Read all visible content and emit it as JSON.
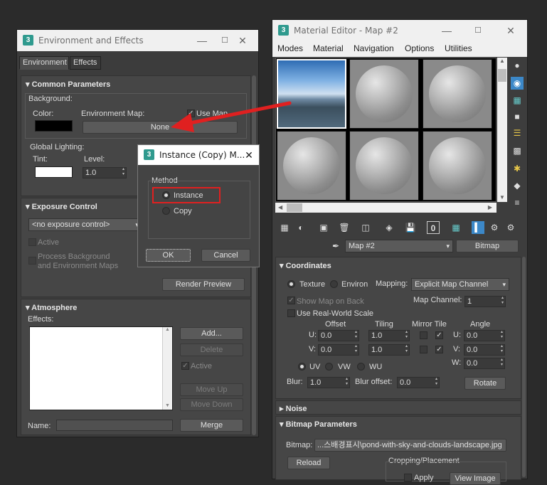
{
  "env": {
    "title": "Environment and Effects",
    "tabs": [
      "Environment",
      "Effects"
    ],
    "common": {
      "header": "Common Parameters",
      "background": "Background:",
      "color": "Color:",
      "envmap": "Environment Map:",
      "usemap": "Use Map",
      "none_btn": "None",
      "global": "Global Lighting:",
      "tint": "Tint:",
      "level": "Level:",
      "level_val": "1.0"
    },
    "exposure": {
      "header": "Exposure Control",
      "dropdown": "<no exposure control>",
      "active": "Active",
      "process_bg_1": "Process Background",
      "process_bg_2": "and Environment Maps",
      "render_preview": "Render Preview"
    },
    "atmosphere": {
      "header": "Atmosphere",
      "effects": "Effects:",
      "add": "Add...",
      "delete": "Delete",
      "active": "Active",
      "move_up": "Move Up",
      "move_down": "Move Down",
      "name": "Name:",
      "merge": "Merge"
    }
  },
  "dialog": {
    "title": "Instance (Copy) M...",
    "method": "Method",
    "instance": "Instance",
    "copy": "Copy",
    "ok": "OK",
    "cancel": "Cancel"
  },
  "mat": {
    "title": "Material Editor - Map #2",
    "menu": [
      "Modes",
      "Material",
      "Navigation",
      "Options",
      "Utilities"
    ],
    "map_name": "Map #2",
    "map_type": "Bitmap",
    "coords": {
      "header": "Coordinates",
      "texture": "Texture",
      "environ": "Environ",
      "mapping": "Mapping:",
      "mapping_val": "Explicit Map Channel",
      "show_map": "Show Map on Back",
      "map_channel": "Map Channel:",
      "map_channel_val": "1",
      "real_world": "Use Real-World Scale",
      "offset": "Offset",
      "tiling": "Tiling",
      "mirror_tile": "Mirror Tile",
      "angle": "Angle",
      "u": "U:",
      "v": "V:",
      "w": "W:",
      "u_off": "0.0",
      "v_off": "0.0",
      "u_tile": "1.0",
      "v_tile": "1.0",
      "u_ang": "0.0",
      "v_ang": "0.0",
      "w_ang": "0.0",
      "uv": "UV",
      "vw": "VW",
      "wu": "WU",
      "blur": "Blur:",
      "blur_val": "1.0",
      "blur_off": "Blur offset:",
      "blur_off_val": "0.0",
      "rotate": "Rotate"
    },
    "noise": {
      "header": "Noise"
    },
    "bitmap": {
      "header": "Bitmap Parameters",
      "label": "Bitmap:",
      "path": "...스배경표시\\pond-with-sky-and-clouds-landscape.jpg",
      "reload": "Reload",
      "cropping": "Cropping/Placement",
      "apply": "Apply",
      "view_image": "View Image"
    }
  },
  "colors": {
    "highlight": "#e02020",
    "accent": "#2f9a8e"
  }
}
